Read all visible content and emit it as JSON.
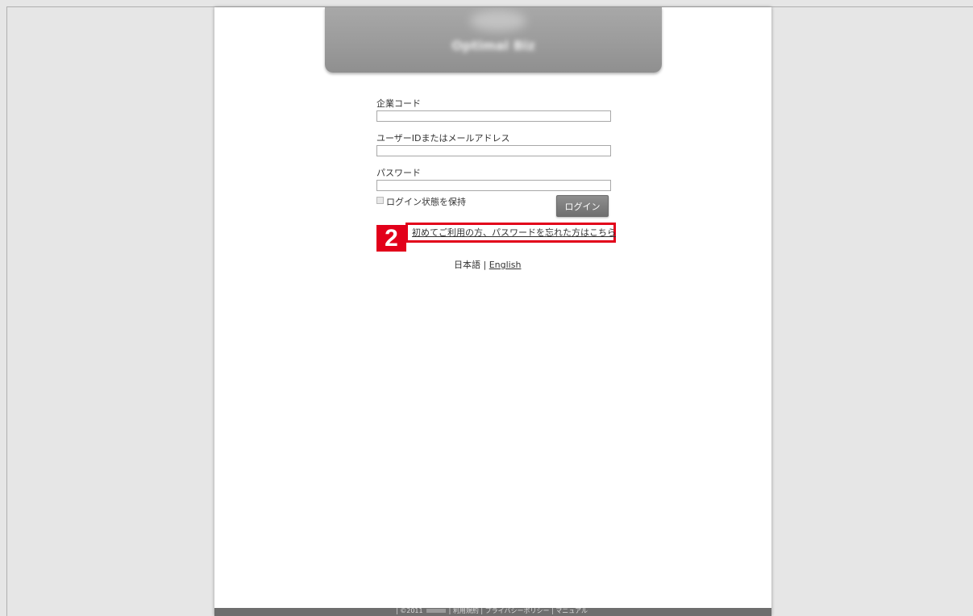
{
  "header": {
    "logo_text": "Optimal Biz"
  },
  "form": {
    "company_code_label": "企業コード",
    "company_code_value": "",
    "user_id_label": "ユーザーIDまたはメールアドレス",
    "user_id_value": "",
    "password_label": "パスワード",
    "password_value": "",
    "remember_label": "ログイン状態を保持",
    "remember_checked": false,
    "login_button": "ログイン"
  },
  "annotation": {
    "step_number": "2",
    "highlight_color": "#e2001a"
  },
  "links": {
    "first_time": "初めてご利用の方、パスワードを忘れた方はこちら"
  },
  "language": {
    "current": "日本語",
    "separator": "|",
    "other": "English"
  },
  "footer": {
    "copyright": "| ©2011",
    "terms": "| 利用規約",
    "privacy": "| プライバシーポリシー",
    "manual": "| マニュアル"
  }
}
